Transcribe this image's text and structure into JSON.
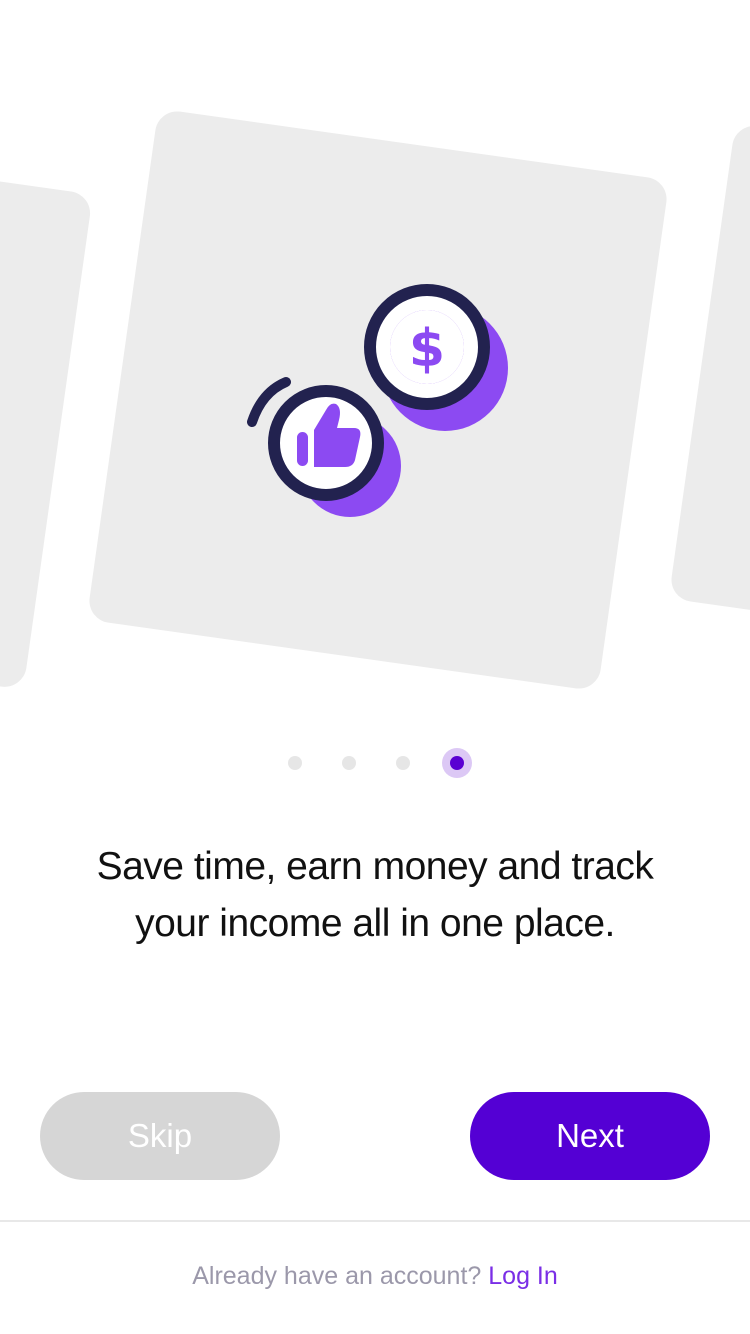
{
  "onboarding": {
    "headline_line1": "Save time, earn money and track",
    "headline_line2": "your income all in one place.",
    "illustration_icons": [
      "dollar-coin-icon",
      "thumbs-up-coin-icon"
    ],
    "pagination": {
      "total": 4,
      "active": 4
    }
  },
  "actions": {
    "skip_label": "Skip",
    "next_label": "Next"
  },
  "footer": {
    "prompt_text": "Already have an account?",
    "login_label": "Log In"
  },
  "colors": {
    "primary": "#5400d4",
    "accent_purple": "#8c4af2",
    "dark_navy": "#22224f",
    "card_bg": "#ececec",
    "skip_bg": "#d6d6d6"
  }
}
